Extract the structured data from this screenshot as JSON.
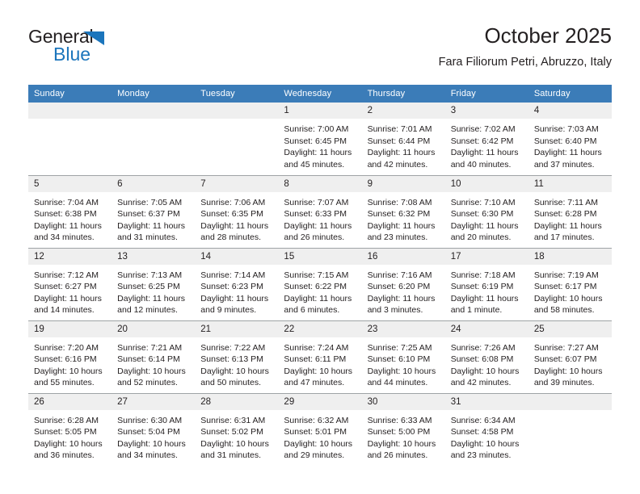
{
  "brand": {
    "name_top": "General",
    "name_bottom": "Blue",
    "accent_color": "#1b75bc"
  },
  "header": {
    "title": "October 2025",
    "subtitle": "Fara Filiorum Petri, Abruzzo, Italy"
  },
  "theme": {
    "header_row_color": "#3b7cb8",
    "daynum_band_color": "#efefef",
    "grid_line_color": "#9fa3a6",
    "text_color": "#231f20"
  },
  "weekday_headers": [
    "Sunday",
    "Monday",
    "Tuesday",
    "Wednesday",
    "Thursday",
    "Friday",
    "Saturday"
  ],
  "weeks": [
    [
      {
        "day": "",
        "empty": true
      },
      {
        "day": "",
        "empty": true
      },
      {
        "day": "",
        "empty": true
      },
      {
        "day": "1",
        "sunrise": "Sunrise: 7:00 AM",
        "sunset": "Sunset: 6:45 PM",
        "daylight1": "Daylight: 11 hours",
        "daylight2": "and 45 minutes."
      },
      {
        "day": "2",
        "sunrise": "Sunrise: 7:01 AM",
        "sunset": "Sunset: 6:44 PM",
        "daylight1": "Daylight: 11 hours",
        "daylight2": "and 42 minutes."
      },
      {
        "day": "3",
        "sunrise": "Sunrise: 7:02 AM",
        "sunset": "Sunset: 6:42 PM",
        "daylight1": "Daylight: 11 hours",
        "daylight2": "and 40 minutes."
      },
      {
        "day": "4",
        "sunrise": "Sunrise: 7:03 AM",
        "sunset": "Sunset: 6:40 PM",
        "daylight1": "Daylight: 11 hours",
        "daylight2": "and 37 minutes."
      }
    ],
    [
      {
        "day": "5",
        "sunrise": "Sunrise: 7:04 AM",
        "sunset": "Sunset: 6:38 PM",
        "daylight1": "Daylight: 11 hours",
        "daylight2": "and 34 minutes."
      },
      {
        "day": "6",
        "sunrise": "Sunrise: 7:05 AM",
        "sunset": "Sunset: 6:37 PM",
        "daylight1": "Daylight: 11 hours",
        "daylight2": "and 31 minutes."
      },
      {
        "day": "7",
        "sunrise": "Sunrise: 7:06 AM",
        "sunset": "Sunset: 6:35 PM",
        "daylight1": "Daylight: 11 hours",
        "daylight2": "and 28 minutes."
      },
      {
        "day": "8",
        "sunrise": "Sunrise: 7:07 AM",
        "sunset": "Sunset: 6:33 PM",
        "daylight1": "Daylight: 11 hours",
        "daylight2": "and 26 minutes."
      },
      {
        "day": "9",
        "sunrise": "Sunrise: 7:08 AM",
        "sunset": "Sunset: 6:32 PM",
        "daylight1": "Daylight: 11 hours",
        "daylight2": "and 23 minutes."
      },
      {
        "day": "10",
        "sunrise": "Sunrise: 7:10 AM",
        "sunset": "Sunset: 6:30 PM",
        "daylight1": "Daylight: 11 hours",
        "daylight2": "and 20 minutes."
      },
      {
        "day": "11",
        "sunrise": "Sunrise: 7:11 AM",
        "sunset": "Sunset: 6:28 PM",
        "daylight1": "Daylight: 11 hours",
        "daylight2": "and 17 minutes."
      }
    ],
    [
      {
        "day": "12",
        "sunrise": "Sunrise: 7:12 AM",
        "sunset": "Sunset: 6:27 PM",
        "daylight1": "Daylight: 11 hours",
        "daylight2": "and 14 minutes."
      },
      {
        "day": "13",
        "sunrise": "Sunrise: 7:13 AM",
        "sunset": "Sunset: 6:25 PM",
        "daylight1": "Daylight: 11 hours",
        "daylight2": "and 12 minutes."
      },
      {
        "day": "14",
        "sunrise": "Sunrise: 7:14 AM",
        "sunset": "Sunset: 6:23 PM",
        "daylight1": "Daylight: 11 hours",
        "daylight2": "and 9 minutes."
      },
      {
        "day": "15",
        "sunrise": "Sunrise: 7:15 AM",
        "sunset": "Sunset: 6:22 PM",
        "daylight1": "Daylight: 11 hours",
        "daylight2": "and 6 minutes."
      },
      {
        "day": "16",
        "sunrise": "Sunrise: 7:16 AM",
        "sunset": "Sunset: 6:20 PM",
        "daylight1": "Daylight: 11 hours",
        "daylight2": "and 3 minutes."
      },
      {
        "day": "17",
        "sunrise": "Sunrise: 7:18 AM",
        "sunset": "Sunset: 6:19 PM",
        "daylight1": "Daylight: 11 hours",
        "daylight2": "and 1 minute."
      },
      {
        "day": "18",
        "sunrise": "Sunrise: 7:19 AM",
        "sunset": "Sunset: 6:17 PM",
        "daylight1": "Daylight: 10 hours",
        "daylight2": "and 58 minutes."
      }
    ],
    [
      {
        "day": "19",
        "sunrise": "Sunrise: 7:20 AM",
        "sunset": "Sunset: 6:16 PM",
        "daylight1": "Daylight: 10 hours",
        "daylight2": "and 55 minutes."
      },
      {
        "day": "20",
        "sunrise": "Sunrise: 7:21 AM",
        "sunset": "Sunset: 6:14 PM",
        "daylight1": "Daylight: 10 hours",
        "daylight2": "and 52 minutes."
      },
      {
        "day": "21",
        "sunrise": "Sunrise: 7:22 AM",
        "sunset": "Sunset: 6:13 PM",
        "daylight1": "Daylight: 10 hours",
        "daylight2": "and 50 minutes."
      },
      {
        "day": "22",
        "sunrise": "Sunrise: 7:24 AM",
        "sunset": "Sunset: 6:11 PM",
        "daylight1": "Daylight: 10 hours",
        "daylight2": "and 47 minutes."
      },
      {
        "day": "23",
        "sunrise": "Sunrise: 7:25 AM",
        "sunset": "Sunset: 6:10 PM",
        "daylight1": "Daylight: 10 hours",
        "daylight2": "and 44 minutes."
      },
      {
        "day": "24",
        "sunrise": "Sunrise: 7:26 AM",
        "sunset": "Sunset: 6:08 PM",
        "daylight1": "Daylight: 10 hours",
        "daylight2": "and 42 minutes."
      },
      {
        "day": "25",
        "sunrise": "Sunrise: 7:27 AM",
        "sunset": "Sunset: 6:07 PM",
        "daylight1": "Daylight: 10 hours",
        "daylight2": "and 39 minutes."
      }
    ],
    [
      {
        "day": "26",
        "sunrise": "Sunrise: 6:28 AM",
        "sunset": "Sunset: 5:05 PM",
        "daylight1": "Daylight: 10 hours",
        "daylight2": "and 36 minutes."
      },
      {
        "day": "27",
        "sunrise": "Sunrise: 6:30 AM",
        "sunset": "Sunset: 5:04 PM",
        "daylight1": "Daylight: 10 hours",
        "daylight2": "and 34 minutes."
      },
      {
        "day": "28",
        "sunrise": "Sunrise: 6:31 AM",
        "sunset": "Sunset: 5:02 PM",
        "daylight1": "Daylight: 10 hours",
        "daylight2": "and 31 minutes."
      },
      {
        "day": "29",
        "sunrise": "Sunrise: 6:32 AM",
        "sunset": "Sunset: 5:01 PM",
        "daylight1": "Daylight: 10 hours",
        "daylight2": "and 29 minutes."
      },
      {
        "day": "30",
        "sunrise": "Sunrise: 6:33 AM",
        "sunset": "Sunset: 5:00 PM",
        "daylight1": "Daylight: 10 hours",
        "daylight2": "and 26 minutes."
      },
      {
        "day": "31",
        "sunrise": "Sunrise: 6:34 AM",
        "sunset": "Sunset: 4:58 PM",
        "daylight1": "Daylight: 10 hours",
        "daylight2": "and 23 minutes."
      },
      {
        "day": "",
        "empty": true
      }
    ]
  ]
}
